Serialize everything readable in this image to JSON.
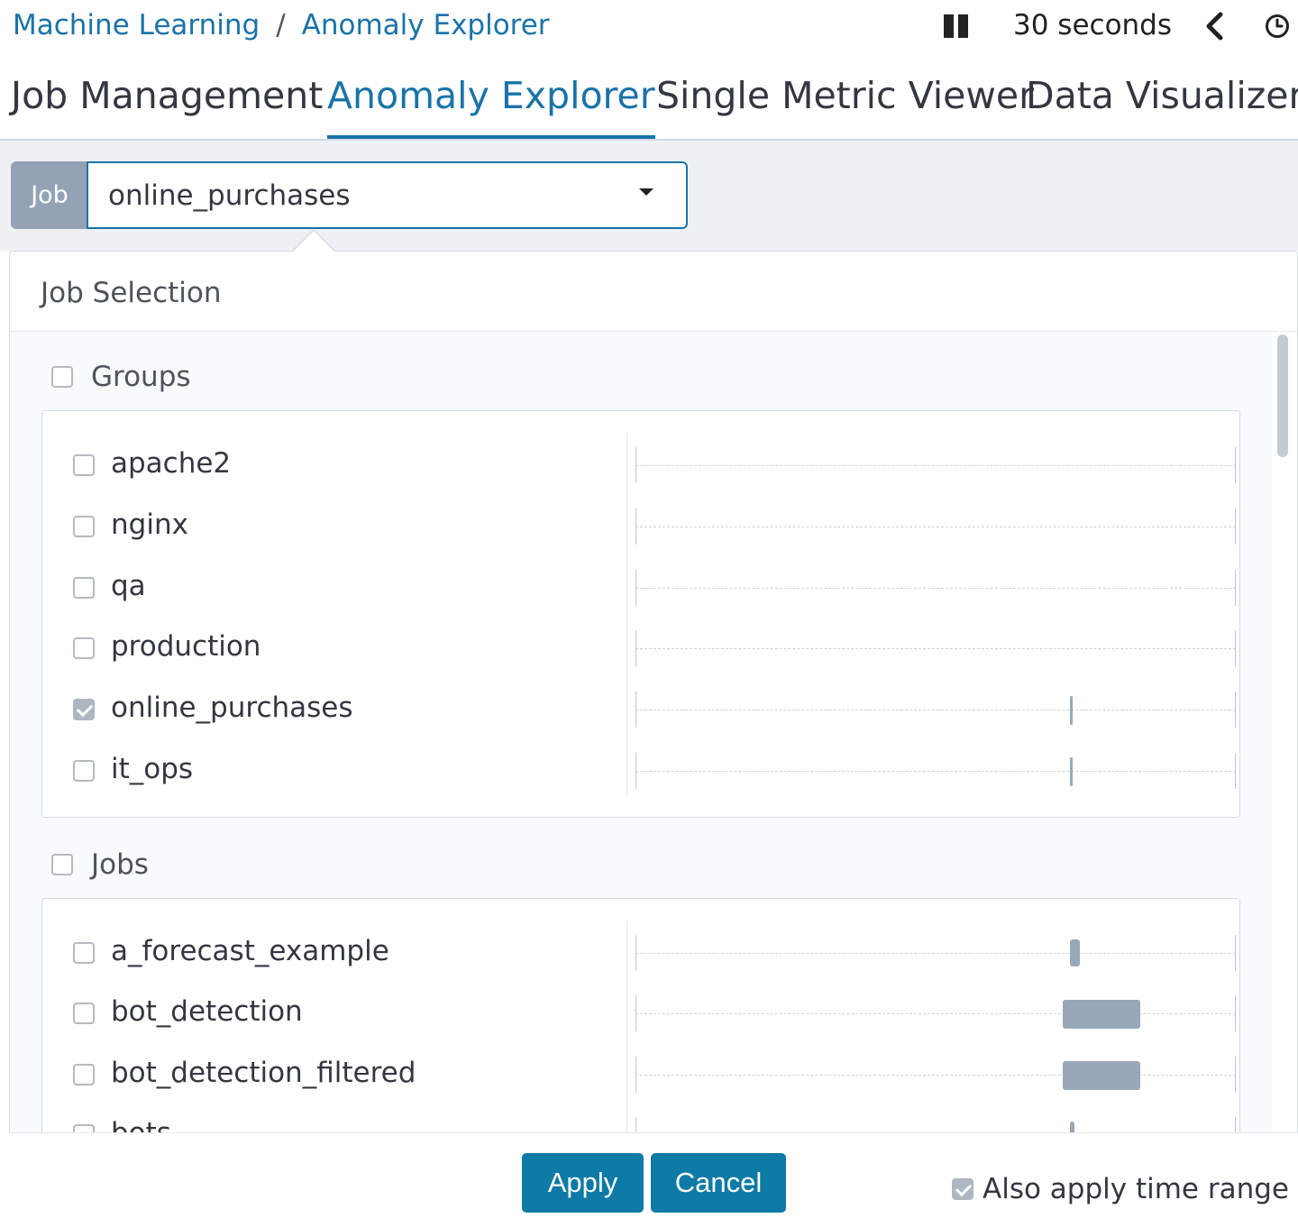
{
  "breadcrumb": {
    "parent": "Machine Learning",
    "separator": "/",
    "current": "Anomaly Explorer"
  },
  "refresh": {
    "interval": "30 seconds"
  },
  "tabs": [
    {
      "label": "Job Management",
      "active": false
    },
    {
      "label": "Anomaly Explorer",
      "active": true
    },
    {
      "label": "Single Metric Viewer",
      "active": false
    },
    {
      "label": "Data Visualizer",
      "active": false
    }
  ],
  "job_picker": {
    "prepend": "Job",
    "selected": "online_purchases"
  },
  "popover": {
    "title": "Job Selection",
    "groups": {
      "label": "Groups",
      "checked": false,
      "items": [
        {
          "label": "apache2",
          "checked": false
        },
        {
          "label": "nginx",
          "checked": false
        },
        {
          "label": "qa",
          "checked": false
        },
        {
          "label": "production",
          "checked": false
        },
        {
          "label": "online_purchases",
          "checked": true
        },
        {
          "label": "it_ops",
          "checked": false
        }
      ]
    },
    "jobs": {
      "label": "Jobs",
      "checked": false,
      "items": [
        {
          "label": "a_forecast_example",
          "checked": false
        },
        {
          "label": "bot_detection",
          "checked": false
        },
        {
          "label": "bot_detection_filtered",
          "checked": false
        },
        {
          "label": "bots",
          "checked": false
        }
      ]
    }
  },
  "footer": {
    "apply_label": "Apply",
    "cancel_label": "Cancel",
    "also_apply_label": "Also apply time range",
    "also_apply_checked": true
  },
  "colors": {
    "accent": "#1a73a8",
    "button": "#0e7aa6",
    "timeline_bar": "#98a8b9"
  }
}
